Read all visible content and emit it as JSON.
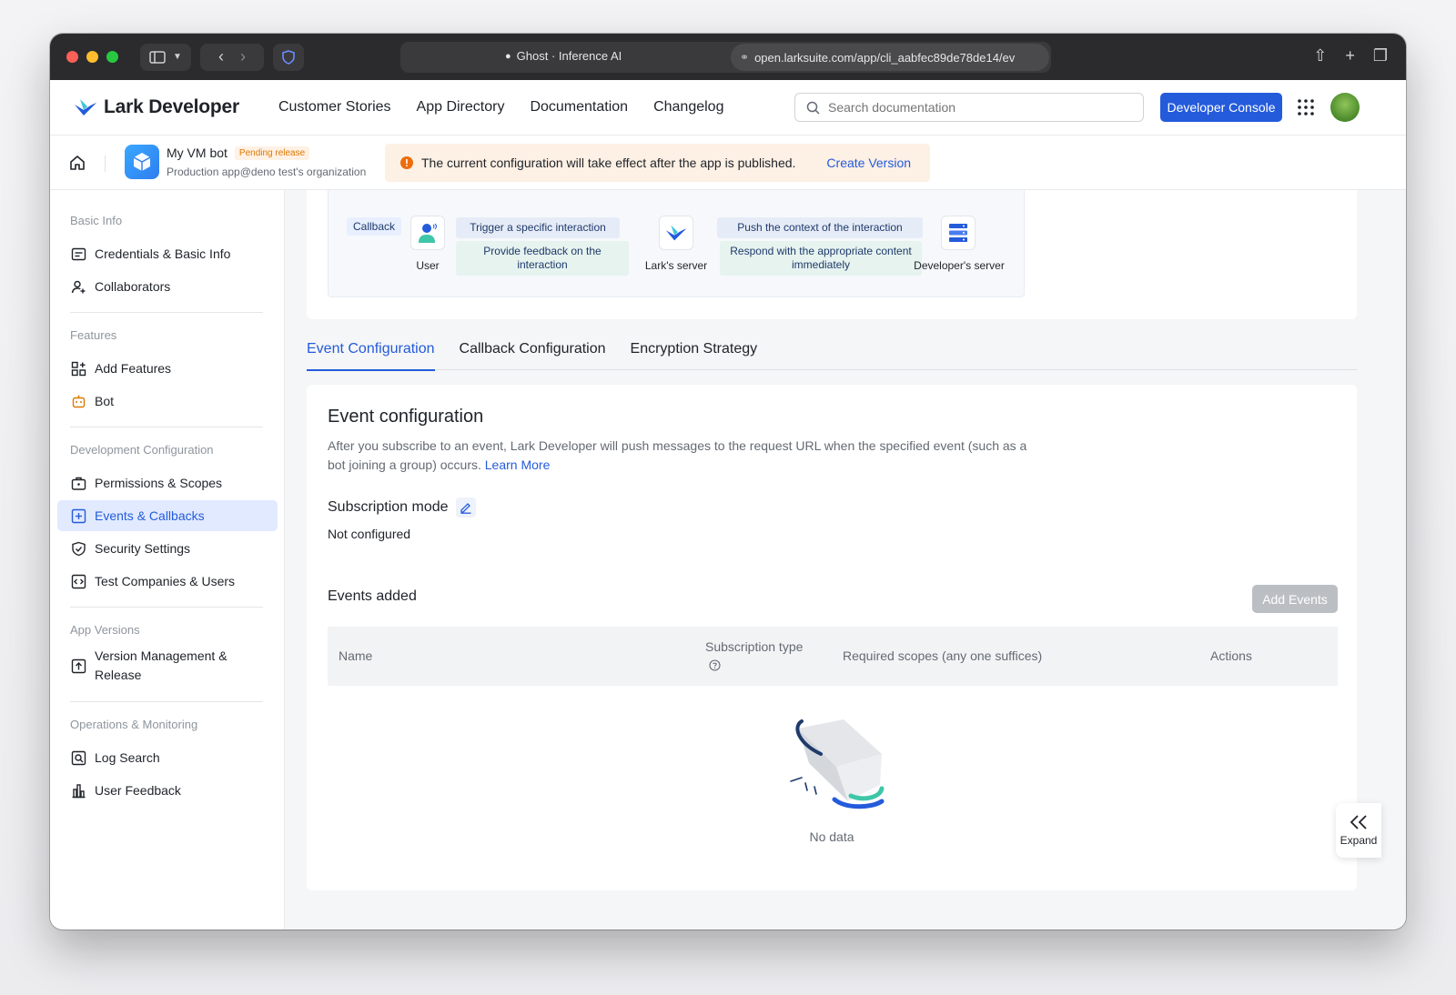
{
  "browser": {
    "tab_title": "Ghost · Inference AI",
    "url": "open.larksuite.com/app/cli_aabfec89de78de14/ev"
  },
  "topnav": {
    "brand": "Lark Developer",
    "links": [
      "Customer Stories",
      "App Directory",
      "Documentation",
      "Changelog"
    ],
    "search_placeholder": "Search documentation",
    "developer_console": "Developer Console"
  },
  "app": {
    "name": "My VM bot",
    "status_badge": "Pending release",
    "org": "Production app@deno test's organization",
    "notice": "The current configuration will take effect after the app is published.",
    "notice_action": "Create Version"
  },
  "sidebar": {
    "sections": [
      {
        "title": "Basic Info",
        "items": [
          {
            "label": "Credentials & Basic Info",
            "icon": "id-card-icon"
          },
          {
            "label": "Collaborators",
            "icon": "user-add-icon"
          }
        ]
      },
      {
        "title": "Features",
        "items": [
          {
            "label": "Add Features",
            "icon": "grid-add-icon"
          },
          {
            "label": "Bot",
            "icon": "bot-icon"
          }
        ]
      },
      {
        "title": "Development Configuration",
        "items": [
          {
            "label": "Permissions & Scopes",
            "icon": "briefcase-icon"
          },
          {
            "label": "Events & Callbacks",
            "icon": "event-icon",
            "active": true
          },
          {
            "label": "Security Settings",
            "icon": "shield-icon"
          },
          {
            "label": "Test Companies & Users",
            "icon": "code-icon"
          }
        ]
      },
      {
        "title": "App Versions",
        "items": [
          {
            "label": "Version Management & Release",
            "icon": "upload-icon"
          }
        ]
      },
      {
        "title": "Operations & Monitoring",
        "items": [
          {
            "label": "Log Search",
            "icon": "log-search-icon"
          },
          {
            "label": "User Feedback",
            "icon": "bar-chart-icon"
          }
        ]
      }
    ]
  },
  "diagram": {
    "tag": "Callback",
    "user_label": "User",
    "lark_label": "Lark's server",
    "dev_label": "Developer's server",
    "arrow1": "Trigger a specific interaction",
    "arrow2": "Provide feedback on the interaction",
    "arrow3": "Push the context of the interaction",
    "arrow4": "Respond with the appropriate content immediately"
  },
  "tabs": [
    "Event Configuration",
    "Callback Configuration",
    "Encryption Strategy"
  ],
  "event_config": {
    "title": "Event configuration",
    "description": "After you subscribe to an event, Lark Developer will push messages to the request URL when the specified event (such as a bot joining a group) occurs.",
    "learn_more": "Learn More",
    "subscription_mode_label": "Subscription mode",
    "subscription_mode_value": "Not configured",
    "events_added_label": "Events added",
    "add_events_button": "Add Events",
    "table_headers": [
      "Name",
      "Subscription type",
      "Required scopes (any one suffices)",
      "Actions"
    ],
    "empty_text": "No data"
  },
  "expand_label": "Expand",
  "colors": {
    "accent": "#245bdb",
    "active_bg": "#e1eaff",
    "pending_badge": "#de7802",
    "notice_bg": "#fdf0e4"
  }
}
